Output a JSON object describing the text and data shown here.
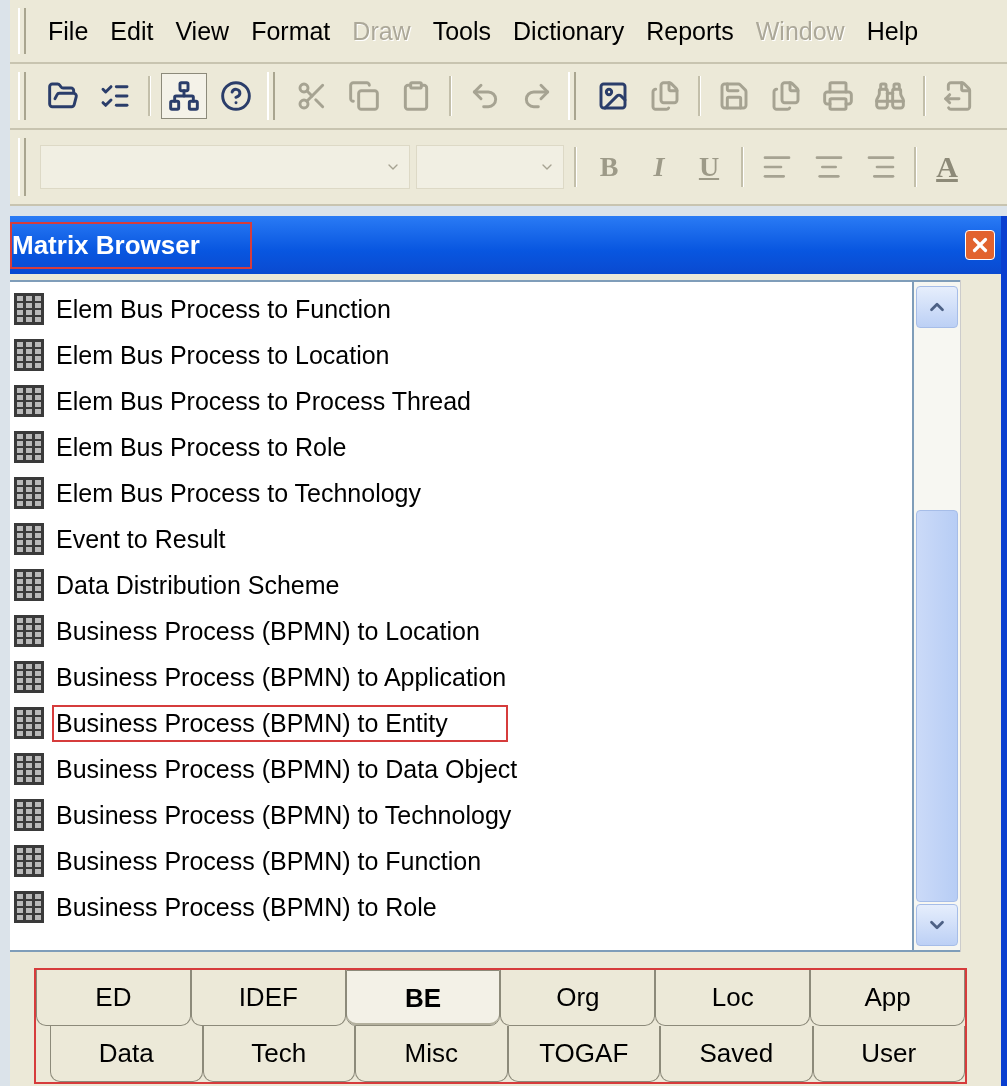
{
  "menu": [
    {
      "label": "File",
      "disabled": false
    },
    {
      "label": "Edit",
      "disabled": false
    },
    {
      "label": "View",
      "disabled": false
    },
    {
      "label": "Format",
      "disabled": false
    },
    {
      "label": "Draw",
      "disabled": true
    },
    {
      "label": "Tools",
      "disabled": false
    },
    {
      "label": "Dictionary",
      "disabled": false
    },
    {
      "label": "Reports",
      "disabled": false
    },
    {
      "label": "Window",
      "disabled": true
    },
    {
      "label": "Help",
      "disabled": false
    }
  ],
  "toolbar": [
    {
      "kind": "icon",
      "disabled": false
    },
    {
      "kind": "icon",
      "disabled": false
    },
    {
      "kind": "sep"
    },
    {
      "kind": "icon",
      "disabled": false,
      "selected": true
    },
    {
      "kind": "icon",
      "disabled": false,
      "selected": false
    },
    {
      "kind": "grip"
    },
    {
      "kind": "icon",
      "disabled": true
    },
    {
      "kind": "icon",
      "disabled": true
    },
    {
      "kind": "icon",
      "disabled": true
    },
    {
      "kind": "sep"
    },
    {
      "kind": "icon",
      "disabled": true
    },
    {
      "kind": "icon",
      "disabled": true
    },
    {
      "kind": "grip"
    },
    {
      "kind": "icon",
      "disabled": false
    },
    {
      "kind": "icon",
      "disabled": true
    },
    {
      "kind": "sep"
    },
    {
      "kind": "icon",
      "disabled": true
    },
    {
      "kind": "icon",
      "disabled": true
    },
    {
      "kind": "icon",
      "disabled": true
    },
    {
      "kind": "icon",
      "disabled": true
    },
    {
      "kind": "sep"
    },
    {
      "kind": "icon",
      "disabled": true
    }
  ],
  "format_bar": {
    "font_combo": {
      "disabled": true
    },
    "size_combo": {
      "disabled": true
    },
    "styles": [
      {
        "label": "B"
      },
      {
        "label": "I"
      },
      {
        "label": "U"
      }
    ],
    "color_button": {
      "label": "A"
    }
  },
  "panel": {
    "title": "Matrix Browser",
    "title_highlighted": true,
    "items": [
      {
        "label": "Elem Bus Process to Function",
        "highlighted": false
      },
      {
        "label": "Elem Bus Process to Location",
        "highlighted": false
      },
      {
        "label": "Elem Bus Process to Process Thread",
        "highlighted": false
      },
      {
        "label": "Elem Bus Process to Role",
        "highlighted": false
      },
      {
        "label": "Elem Bus Process to Technology",
        "highlighted": false
      },
      {
        "label": "Event to Result",
        "highlighted": false
      },
      {
        "label": "Data Distribution Scheme",
        "highlighted": false
      },
      {
        "label": "Business Process (BPMN) to Location",
        "highlighted": false
      },
      {
        "label": "Business Process (BPMN) to Application",
        "highlighted": false
      },
      {
        "label": "Business Process (BPMN) to Entity",
        "highlighted": true
      },
      {
        "label": "Business Process (BPMN) to Data Object",
        "highlighted": false
      },
      {
        "label": "Business Process (BPMN) to Technology",
        "highlighted": false
      },
      {
        "label": "Business Process (BPMN) to Function",
        "highlighted": false
      },
      {
        "label": "Business Process (BPMN) to Role",
        "highlighted": false
      }
    ],
    "tabs_highlighted": true,
    "tab_rows": [
      [
        {
          "label": "ED",
          "selected": false
        },
        {
          "label": "IDEF",
          "selected": false
        },
        {
          "label": "BE",
          "selected": true
        },
        {
          "label": "Org",
          "selected": false
        },
        {
          "label": "Loc",
          "selected": false
        },
        {
          "label": "App",
          "selected": false
        }
      ],
      [
        {
          "label": "Data",
          "selected": false
        },
        {
          "label": "Tech",
          "selected": false
        },
        {
          "label": "Misc",
          "selected": false
        },
        {
          "label": "TOGAF",
          "selected": false
        },
        {
          "label": "Saved",
          "selected": false
        },
        {
          "label": "User",
          "selected": false
        }
      ]
    ]
  }
}
